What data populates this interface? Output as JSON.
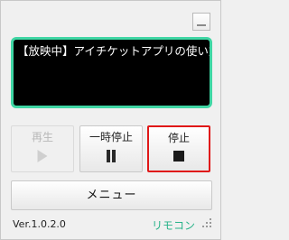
{
  "app": {
    "version": "Ver.1.0.2.0",
    "brand": "リモコン"
  },
  "display": {
    "status_text": "【放映中】アイチケットアプリの使い方",
    "border_color": "#3fd6a4"
  },
  "controls": {
    "play_label": "再生",
    "pause_label": "一時停止",
    "stop_label": "停止",
    "play_enabled": false,
    "highlight_color": "#e01818"
  },
  "menu": {
    "label": "メニュー"
  },
  "icons": {
    "minimize": "minimize-icon",
    "play": "play-icon",
    "pause": "pause-icon",
    "stop": "stop-icon",
    "resize": "resize-grip-icon"
  }
}
